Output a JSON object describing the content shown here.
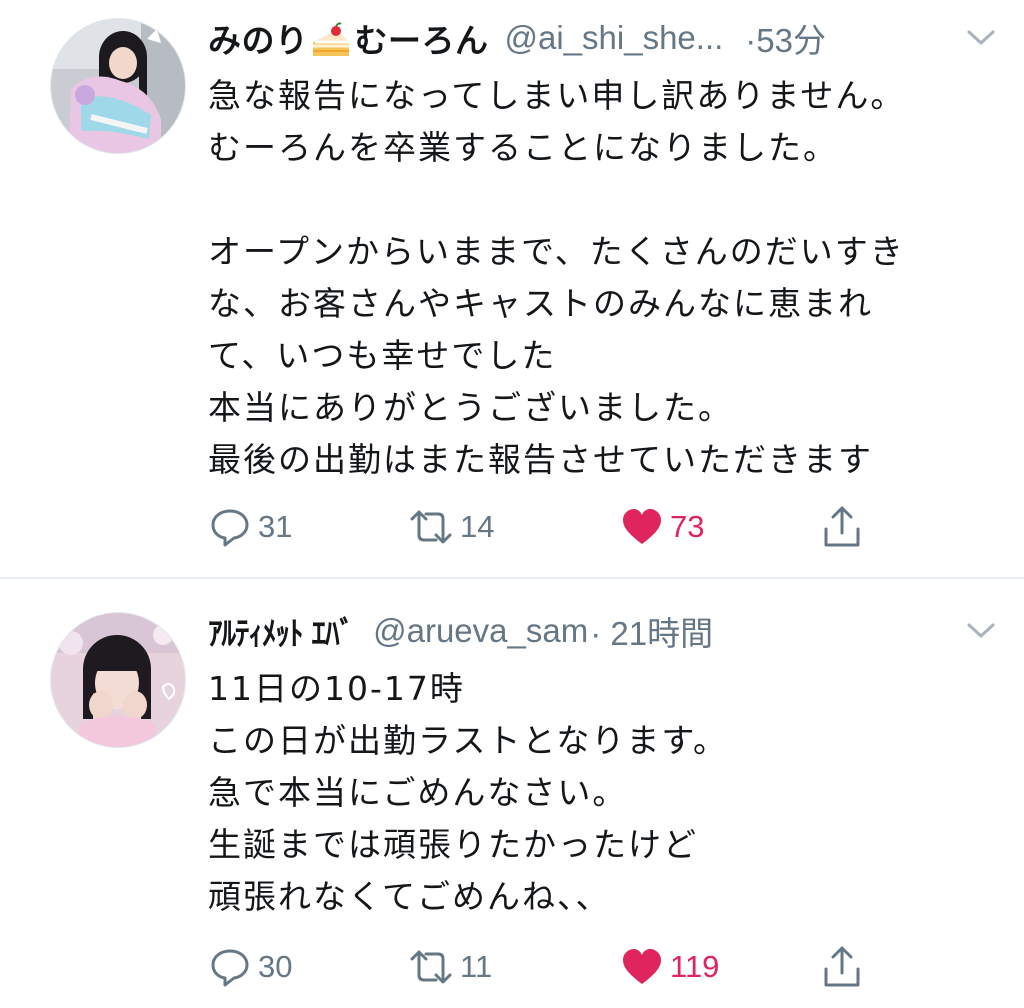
{
  "tweets": [
    {
      "display_name_before": "みのり",
      "display_name_emoji": "cake-icon",
      "display_name_after": "むーろん",
      "handle": "@ai_shi_she...",
      "timestamp": "·53分",
      "body_lines": [
        "急な報告になってしまい申し訳ありません。",
        "むーろんを卒業することになりました。",
        "",
        "オープンからいままで、たくさんのだいすき",
        "な、お客さんやキャストのみんなに恵まれ",
        "て、いつも幸せでした",
        "本当にありがとうございました。",
        "最後の出勤はまた報告させていただきます"
      ],
      "replies": "31",
      "retweets": "14",
      "likes": "73",
      "liked": true
    },
    {
      "display_name": "ｱﾙﾃｨﾒｯﾄ ｴﾊﾞ",
      "handle": "@arueva_sam",
      "timestamp": "· 21時間",
      "body_lines": [
        "11日の10-17時",
        "この日が出勤ラストとなります。",
        "急で本当にごめんなさい。",
        "生誕までは頑張りたかったけど",
        "頑張れなくてごめんね、、"
      ],
      "replies": "30",
      "retweets": "11",
      "likes": "119",
      "liked": true
    }
  ],
  "colors": {
    "text": "#14171a",
    "secondary": "#657786",
    "like": "#e0245e",
    "divider": "#e6ecf0"
  }
}
